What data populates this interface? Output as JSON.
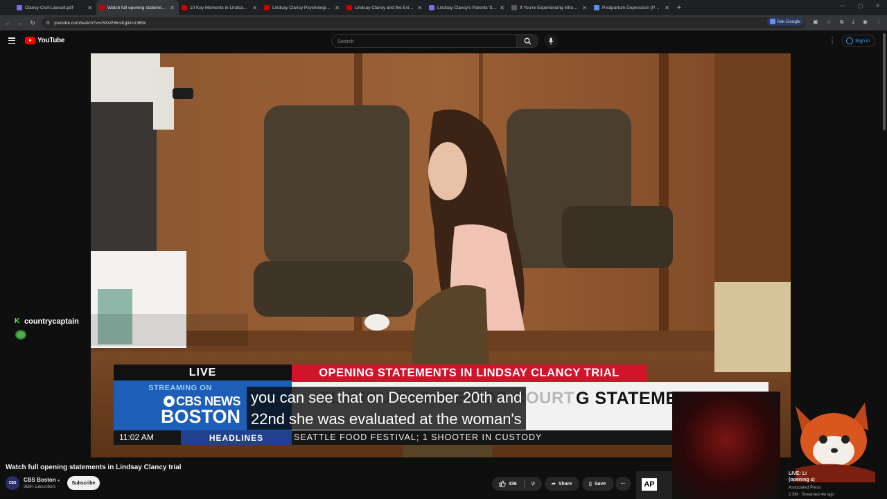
{
  "browser": {
    "tabs": [
      {
        "label": "Clancy-Civil-Lawsuit.pdf",
        "favicon": "pdf-icon",
        "active": false
      },
      {
        "label": "Watch full opening statements",
        "favicon": "youtube-icon",
        "active": true
      },
      {
        "label": "10 Key Moments in Lindsay Cla",
        "favicon": "youtube-icon",
        "active": false
      },
      {
        "label": "Lindsay Clancy Psychologist Di",
        "favicon": "youtube-icon",
        "active": false
      },
      {
        "label": "Lindsay Clancy and the Eviden",
        "favicon": "youtube-icon",
        "active": false
      },
      {
        "label": "Lindsay Clancy's Parents' $1 M",
        "favicon": "pdf-icon",
        "active": false
      },
      {
        "label": "If You're Experiencing Intrusive",
        "favicon": "page-icon",
        "active": false
      },
      {
        "label": "Postpartum Depression (PPD): ",
        "favicon": "doc-icon",
        "active": false
      }
    ],
    "new_tab": "+",
    "url": "youtube.com/watch?v=c5XvPt6csKg&t=1369s",
    "ask_google": "Ask Google"
  },
  "youtube": {
    "logo_text": "YouTube",
    "search_placeholder": "Search",
    "sign_in": "Sign in"
  },
  "overlay": {
    "chat_user": "countrycaptain",
    "chat_platform_glyph": "K"
  },
  "broadcast": {
    "live": "LIVE",
    "headline_red": "OPENING STATEMENTS IN LINDSAY CLANCY TRIAL",
    "streaming_on": "STREAMING ON",
    "network": "CBS NEWS",
    "city": "BOSTON",
    "faded_text": "PLYMOUTH SUPERIOR COURT",
    "white_big": "G STATEMEN",
    "time": "11:02 AM",
    "headlines_label": "HEADLINES",
    "crawl": "SEATTLE FOOD FESTIVAL; 1 SHOOTER IN CUSTODY"
  },
  "caption": {
    "line1": "you can see that on December 20th and",
    "line2": "22nd she was evaluated at the woman's"
  },
  "video": {
    "title": "Watch full opening statements in Lindsay Clancy trial",
    "channel": "CBS Boston",
    "channel_avatar_text": "CBS",
    "subscribers": "368K subscribers",
    "subscribe": "Subscribe",
    "likes": "436",
    "share": "Share",
    "save": "Save",
    "more": "···"
  },
  "recommendation": {
    "thumb_badge": "AP",
    "title_line1": "LIVE: Li",
    "title_line2": "(opening s)",
    "channel": "Associated Press",
    "meta": "2.3M · Streamed 4w ago"
  }
}
